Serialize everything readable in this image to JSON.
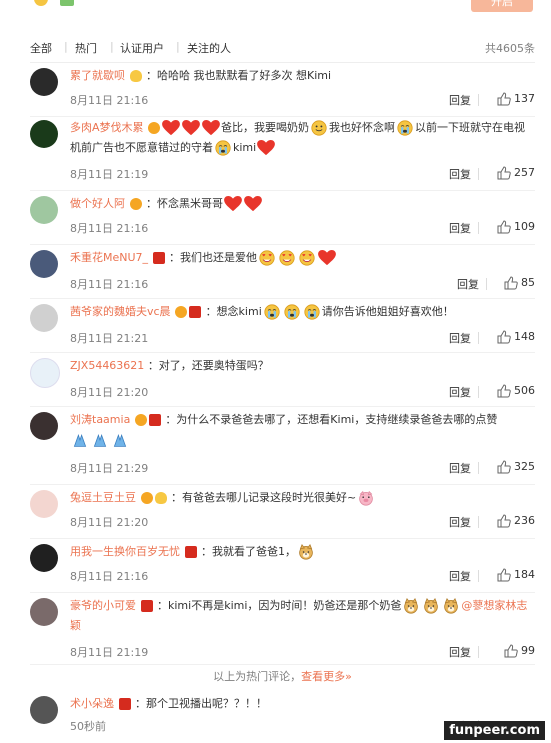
{
  "top_button": "开启",
  "tabs": {
    "all": "全部",
    "hot": "热门",
    "verified": "认证用户",
    "following": "关注的人",
    "total": "共4605条"
  },
  "reply_label": "回复",
  "footer": {
    "text": "以上为热门评论，",
    "more": "查看更多»"
  },
  "watermark": "funpeer.com",
  "colors": {
    "username": "#eb7350",
    "heart": "#e8352b",
    "flag": "#d52b1e"
  },
  "comments": [
    {
      "user": "累了就歇呗",
      "text": "：哈哈哈 我也默默看了好多次 想Kimi",
      "time": "8月11日 21:16",
      "likes": "137"
    },
    {
      "user": "多肉A梦伐木累",
      "text_a": "爸比，我要喝奶奶",
      "text_b": "我也好怀念啊",
      "text_c": "以前一下班就守在电视机前广告也不愿意错过的守着",
      "text_d": "kimi",
      "time": "8月11日 21:19",
      "likes": "257"
    },
    {
      "user": "做个好人阿",
      "text": "：怀念黑米哥哥",
      "time": "8月11日 21:16",
      "likes": "109"
    },
    {
      "user": "禾重花MeNU7_",
      "text": "：我们也还是爱他",
      "time": "8月11日 21:16",
      "likes": "85"
    },
    {
      "user": "茜爷家的魏婚夫vc晨",
      "text_a": "：想念kimi",
      "text_b": "请你告诉他姐姐好喜欢他！",
      "time": "8月11日 21:21",
      "likes": "148"
    },
    {
      "user": "ZJX54463621",
      "text": "：对了，还要奥特蛋吗？",
      "time": "8月11日 21:20",
      "likes": "506"
    },
    {
      "user": "刘涛taamia",
      "text": "：为什么不录爸爸去哪了，还想看Kimi，支持继续录爸爸去哪的点赞",
      "time": "8月11日 21:29",
      "likes": "325"
    },
    {
      "user": "兔逗土豆土豆",
      "text": "：有爸爸去哪儿记录这段时光很美好~",
      "time": "8月11日 21:20",
      "likes": "236"
    },
    {
      "user": "用我一生换你百岁无忧",
      "text": "：我就看了爸爸1，",
      "time": "8月11日 21:16",
      "likes": "184"
    },
    {
      "user": "豪爷的小可爱",
      "text_a": "：kimi不再是kimi，因为时间！奶爸还是那个奶爸",
      "text_b": "@蓼想家林志颖",
      "time": "8月11日 21:19",
      "likes": "99"
    },
    {
      "user": "术小朵逸",
      "text": "：那个卫视播出呢？？！！",
      "time": "50秒前",
      "likes": ""
    }
  ]
}
